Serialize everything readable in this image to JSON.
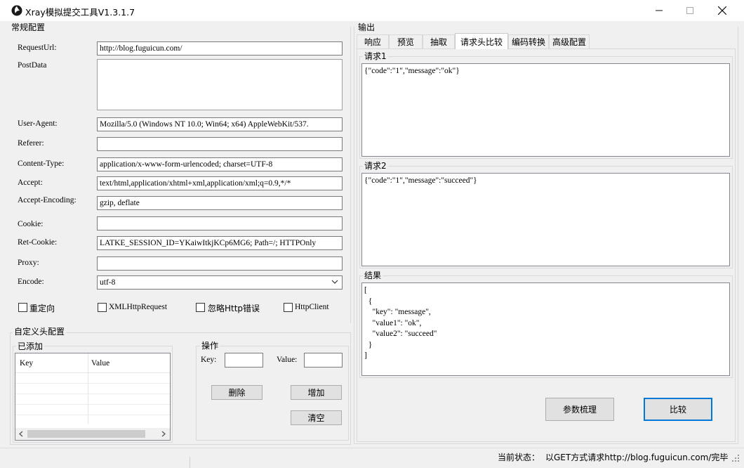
{
  "window": {
    "title": "Xray模拟提交工具V1.3.1.7"
  },
  "general": {
    "group_title": "常规配置",
    "fields": [
      {
        "label": "RequestUrl:",
        "value": "http://blog.fuguicun.com/"
      },
      {
        "label": "PostData",
        "value": ""
      },
      {
        "label": "User-Agent:",
        "value": "Mozilla/5.0 (Windows NT 10.0; Win64; x64) AppleWebKit/537."
      },
      {
        "label": "Referer:",
        "value": ""
      },
      {
        "label": "Content-Type:",
        "value": "application/x-www-form-urlencoded; charset=UTF-8"
      },
      {
        "label": "Accept:",
        "value": "text/html,application/xhtml+xml,application/xml;q=0.9,*/*"
      },
      {
        "label": "Accept-Encoding:",
        "value": "gzip, deflate"
      },
      {
        "label": "Cookie:",
        "value": ""
      },
      {
        "label": "Ret-Cookie:",
        "value": "LATKE_SESSION_ID=YKaiwItkjKCp6MG6; Path=/; HTTPOnly"
      },
      {
        "label": "Proxy:",
        "value": ""
      },
      {
        "label": "Encode:",
        "value": "utf-8"
      }
    ],
    "checkboxes": [
      "重定向",
      "XMLHttpRequest",
      "忽略Http错误",
      "HttpClient"
    ]
  },
  "custom_headers": {
    "group_title": "自定义头配置",
    "added": {
      "title": "已添加",
      "columns": [
        "Key",
        "Value"
      ]
    },
    "ops": {
      "title": "操作",
      "key_label": "Key:",
      "value_label": "Value:",
      "delete": "删除",
      "add": "增加",
      "clear": "清空"
    }
  },
  "output": {
    "group_title": "输出",
    "tabs": [
      "响应",
      "预览",
      "抽取",
      "请求头比较",
      "编码转换",
      "高级配置"
    ],
    "request1": {
      "title": "请求1",
      "text": "{\"code\":\"1\",\"message\":\"ok\"}"
    },
    "request2": {
      "title": "请求2",
      "text": "{\"code\":\"1\",\"message\":\"succeed\"}"
    },
    "result": {
      "title": "结果",
      "text": "[\n  {\n    \"key\": \"message\",\n    \"value1\": \"ok\",\n    \"value2\": \"succeed\"\n  }\n]"
    },
    "buttons": {
      "params": "参数梳理",
      "compare": "比较"
    }
  },
  "status": {
    "label": "当前状态：",
    "text": "以GET方式请求http://blog.fuguicun.com/完毕"
  }
}
